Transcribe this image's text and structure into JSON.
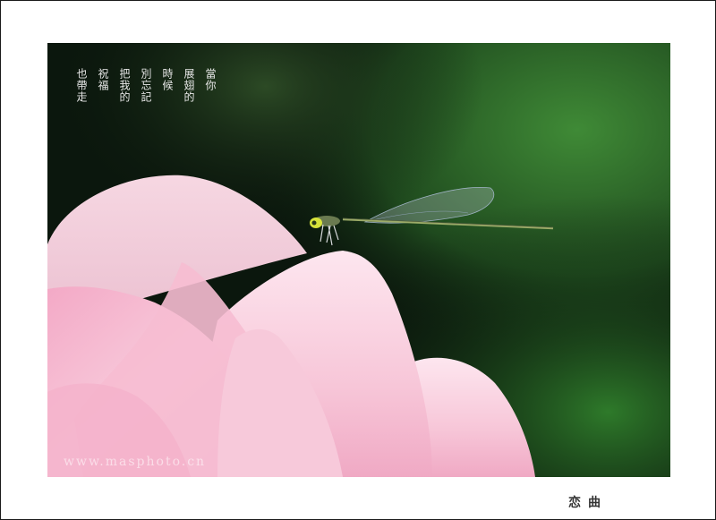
{
  "poem": {
    "columns": [
      "當你",
      "展翅的",
      "時候",
      "別忘記",
      "把我的",
      "祝福",
      "也帶走"
    ]
  },
  "watermark": "www.masphoto.cn",
  "caption": "恋曲",
  "colors": {
    "petal_pink": "#f4b8cf",
    "background_green": "#2f6b2a",
    "frame_border": "#1a1a1a"
  }
}
